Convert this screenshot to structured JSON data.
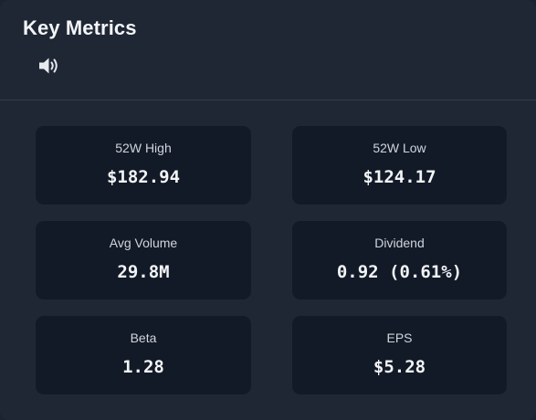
{
  "widget": {
    "title": "Key Metrics",
    "audio_icon": "speaker-volume-icon"
  },
  "metrics": [
    {
      "label": "52W High",
      "value": "$182.94"
    },
    {
      "label": "52W Low",
      "value": "$124.17"
    },
    {
      "label": "Avg Volume",
      "value": "29.8M"
    },
    {
      "label": "Dividend",
      "value": "0.92 (0.61%)"
    },
    {
      "label": "Beta",
      "value": "1.28"
    },
    {
      "label": "EPS",
      "value": "$5.28"
    }
  ],
  "colors": {
    "panel_bg": "#1f2735",
    "card_bg": "#131a27",
    "text_primary": "#f2f4f7",
    "text_secondary": "#cfd5de",
    "divider": "#323b4a"
  }
}
